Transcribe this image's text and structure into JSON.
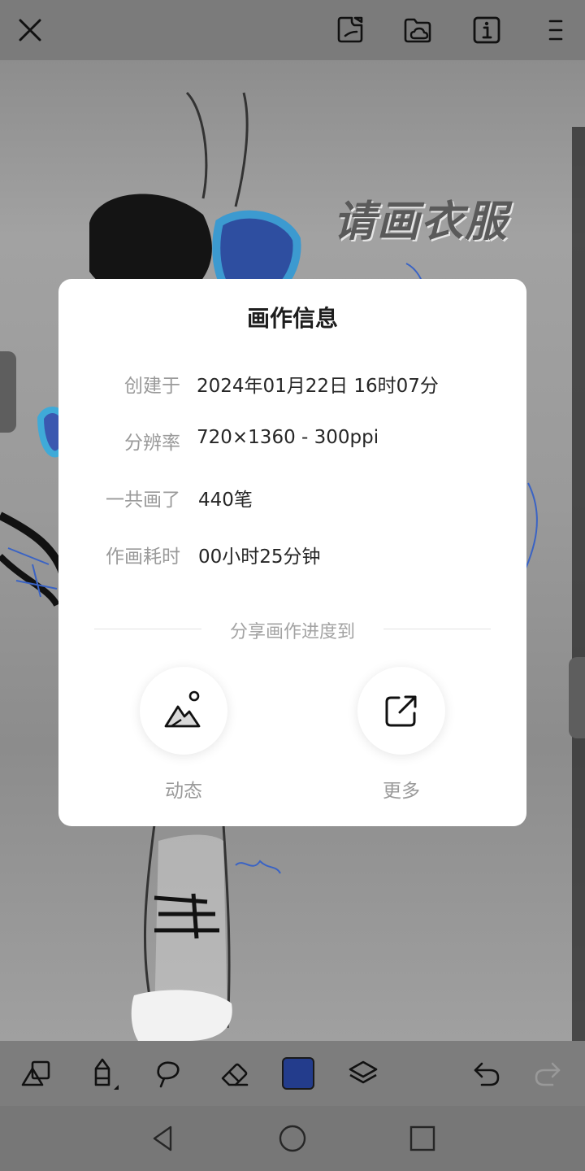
{
  "dialog": {
    "title": "画作信息",
    "rows": [
      {
        "label": "创建于",
        "value": "2024年01月22日 16时07分"
      },
      {
        "label": "分辨率",
        "value": "720×1360 - 300ppi"
      },
      {
        "label": "一共画了",
        "value": "440笔"
      },
      {
        "label": "作画耗时",
        "value": "00小时25分钟"
      }
    ],
    "share_heading": "分享画作进度到",
    "share_targets": [
      {
        "label": "动态",
        "icon": "mountain-image-icon"
      },
      {
        "label": "更多",
        "icon": "external-share-icon"
      }
    ]
  },
  "canvas": {
    "artwork_text": "请画衣服"
  },
  "topbar": {
    "icons": [
      "close-icon",
      "sticker-icon",
      "cloud-folder-icon",
      "info-icon",
      "menu-icon"
    ]
  },
  "bottombar": {
    "icons": [
      "shapes-icon",
      "pencil-icon",
      "lasso-icon",
      "eraser-icon",
      "color-swatch",
      "layers-icon",
      "undo-icon",
      "redo-icon"
    ],
    "current_color": "#233c8c"
  },
  "navbar": {
    "icons": [
      "back-icon",
      "home-icon",
      "recents-icon"
    ]
  }
}
